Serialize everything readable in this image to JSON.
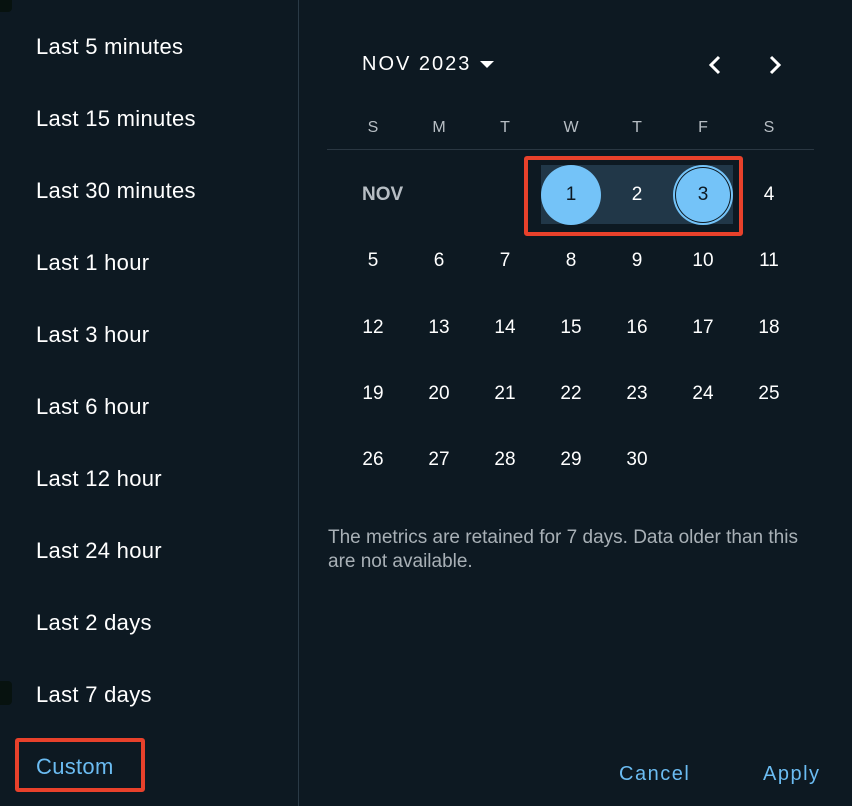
{
  "presets": {
    "items": [
      {
        "label": "Last 5 minutes"
      },
      {
        "label": "Last 15 minutes"
      },
      {
        "label": "Last 30 minutes"
      },
      {
        "label": "Last 1 hour"
      },
      {
        "label": "Last 3 hour"
      },
      {
        "label": "Last 6 hour"
      },
      {
        "label": "Last 12 hour"
      },
      {
        "label": "Last 24 hour"
      },
      {
        "label": "Last 2 days"
      },
      {
        "label": "Last 7 days"
      }
    ],
    "custom": {
      "label": "Custom",
      "selected": true
    }
  },
  "calendar": {
    "month_year": "NOV 2023",
    "inline_month": "NOV",
    "prev_icon": "chevron-left-icon",
    "next_icon": "chevron-right-icon",
    "dropdown_icon": "caret-down-icon",
    "weekdays": [
      "S",
      "M",
      "T",
      "W",
      "T",
      "F",
      "S"
    ],
    "first_weekday_index": 3,
    "days_in_month": 30,
    "range_start": 1,
    "range_end": 3,
    "in_range": [
      2
    ]
  },
  "note": "The metrics are retained for 7 days. Data older than this are not available.",
  "actions": {
    "cancel": "Cancel",
    "apply": "Apply"
  },
  "colors": {
    "background": "#0d1922",
    "accent": "#6bbcf2",
    "selected_day": "#74c3f8",
    "range_fill": "#213748",
    "highlight_box": "#e8412b"
  }
}
